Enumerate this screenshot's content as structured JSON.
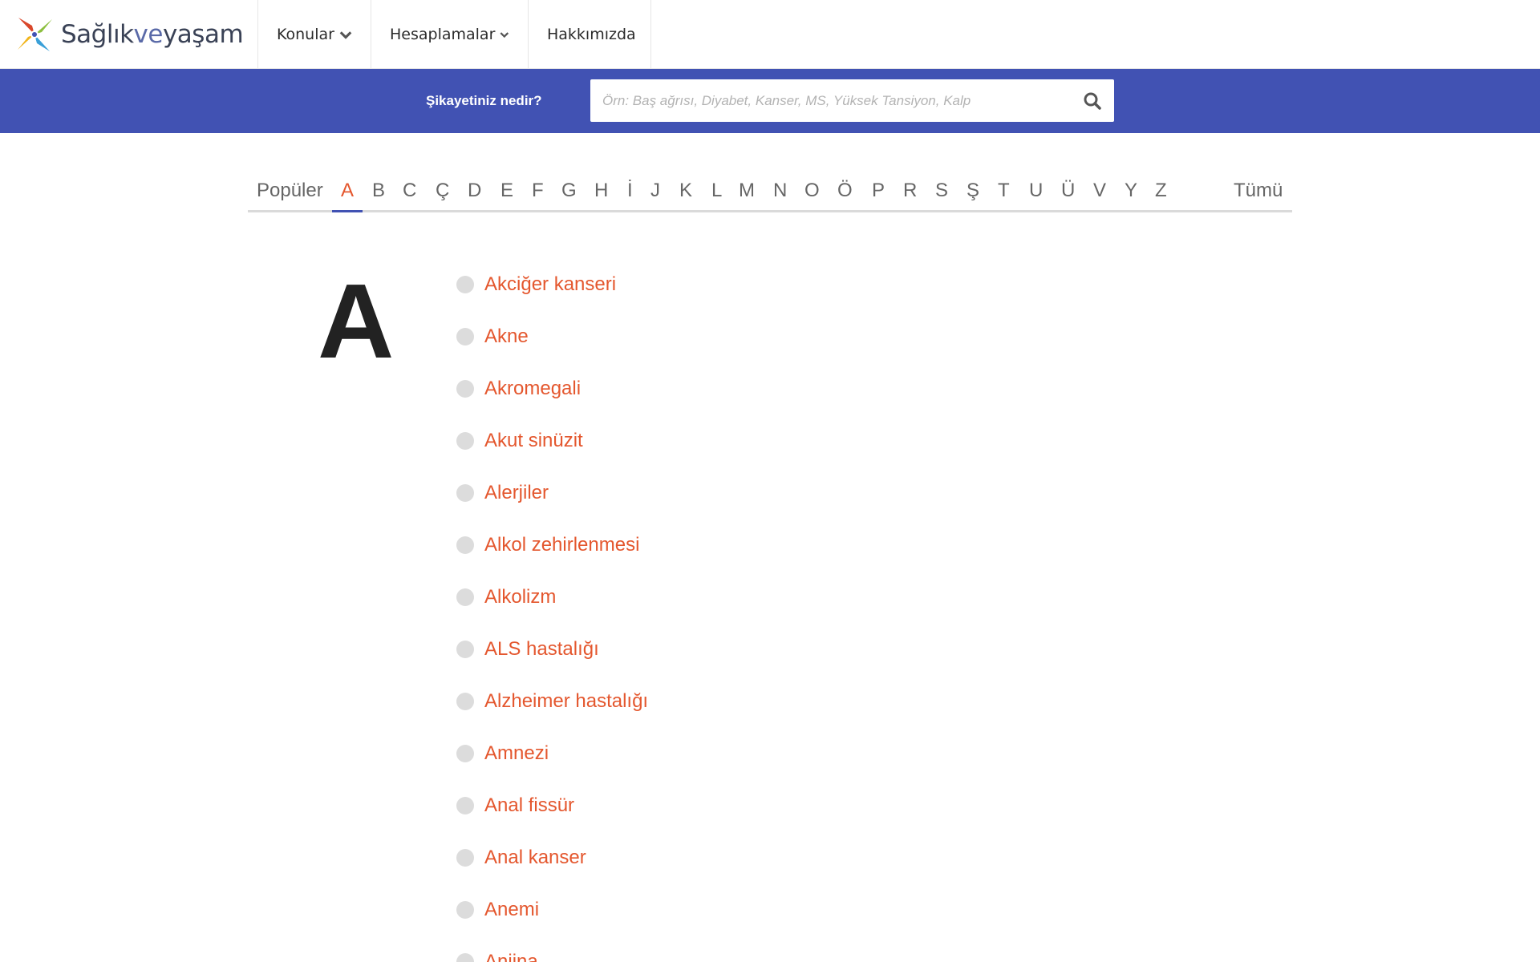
{
  "header": {
    "logo": {
      "prefix": "Sağlık",
      "middle": "ve",
      "suffix": "yaşam"
    },
    "nav": [
      {
        "label": "Konular",
        "has_dropdown": true
      },
      {
        "label": "Hesaplamalar",
        "has_dropdown": true
      },
      {
        "label": "Hakkımızda",
        "has_dropdown": false
      }
    ]
  },
  "search": {
    "label": "Şikayetiniz nedir?",
    "placeholder": "Örn: Baş ağrısı, Diyabet, Kanser, MS, Yüksek Tansiyon, Kalp",
    "value": "",
    "icon": "search-icon"
  },
  "alphabet": {
    "popular_label": "Popüler",
    "letters": [
      "A",
      "B",
      "C",
      "Ç",
      "D",
      "E",
      "F",
      "G",
      "H",
      "İ",
      "J",
      "K",
      "L",
      "M",
      "N",
      "O",
      "Ö",
      "P",
      "R",
      "S",
      "Ş",
      "T",
      "U",
      "Ü",
      "V",
      "Y",
      "Z"
    ],
    "active": "A",
    "all_label": "Tümü"
  },
  "section": {
    "letter": "A",
    "topics": [
      "Akciğer kanseri",
      "Akne",
      "Akromegali",
      "Akut sinüzit",
      "Alerjiler",
      "Alkol zehirlenmesi",
      "Alkolizm",
      "ALS hastalığı",
      "Alzheimer hastalığı",
      "Amnezi",
      "Anal fissür",
      "Anal kanser",
      "Anemi",
      "Anjina"
    ]
  },
  "colors": {
    "brand_blue": "#4152b3",
    "accent_orange": "#e4572e",
    "bullet_gray": "#dcdcdc"
  }
}
